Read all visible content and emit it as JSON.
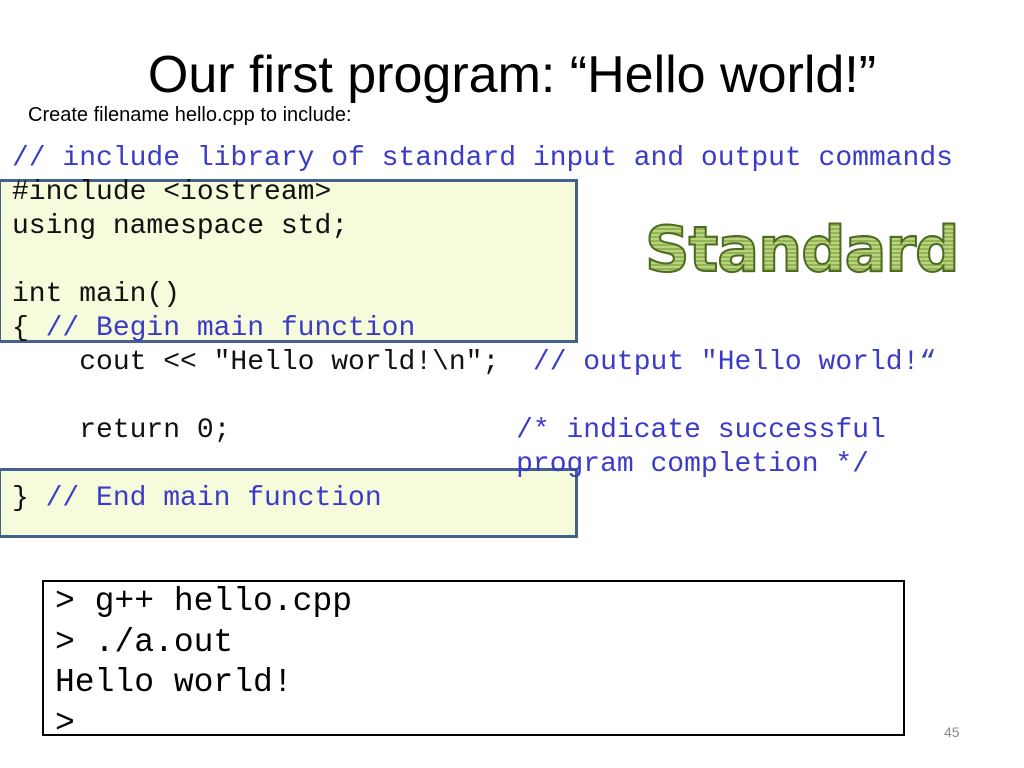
{
  "slide": {
    "title": "Our first program: “Hello world!”",
    "subtitle": "Create filename  hello.cpp to include:",
    "wordart": "Standard",
    "page_number": "45"
  },
  "code": {
    "lines": [
      [
        {
          "t": "// include library of standard input and output commands",
          "c": "comment"
        }
      ],
      [
        {
          "t": "#include <iostream>",
          "c": "code"
        }
      ],
      [
        {
          "t": "using namespace std;",
          "c": "code"
        }
      ],
      [
        {
          "t": "",
          "c": "code"
        }
      ],
      [
        {
          "t": "int main()",
          "c": "code"
        }
      ],
      [
        {
          "t": "{ ",
          "c": "code"
        },
        {
          "t": "// Begin main function",
          "c": "comment"
        }
      ],
      [
        {
          "t": "    cout << \"Hello world!\\n\";  ",
          "c": "code"
        },
        {
          "t": "// output \"Hello world!“",
          "c": "comment"
        }
      ],
      [
        {
          "t": "",
          "c": "code"
        }
      ],
      [
        {
          "t": "    return 0;                 ",
          "c": "code"
        },
        {
          "t": "/* indicate successful",
          "c": "comment"
        }
      ],
      [
        {
          "t": "                              program completion */",
          "c": "comment"
        }
      ],
      [
        {
          "t": "} ",
          "c": "code"
        },
        {
          "t": "// End main function",
          "c": "comment"
        }
      ]
    ]
  },
  "terminal": {
    "lines": [
      "> g++ hello.cpp",
      "> ./a.out",
      "Hello world!",
      ">"
    ]
  },
  "colors": {
    "comment": "#3b3bc8",
    "code": "#111111",
    "highlight_fill": "#f6fbdc",
    "highlight_border": "#44628c"
  }
}
